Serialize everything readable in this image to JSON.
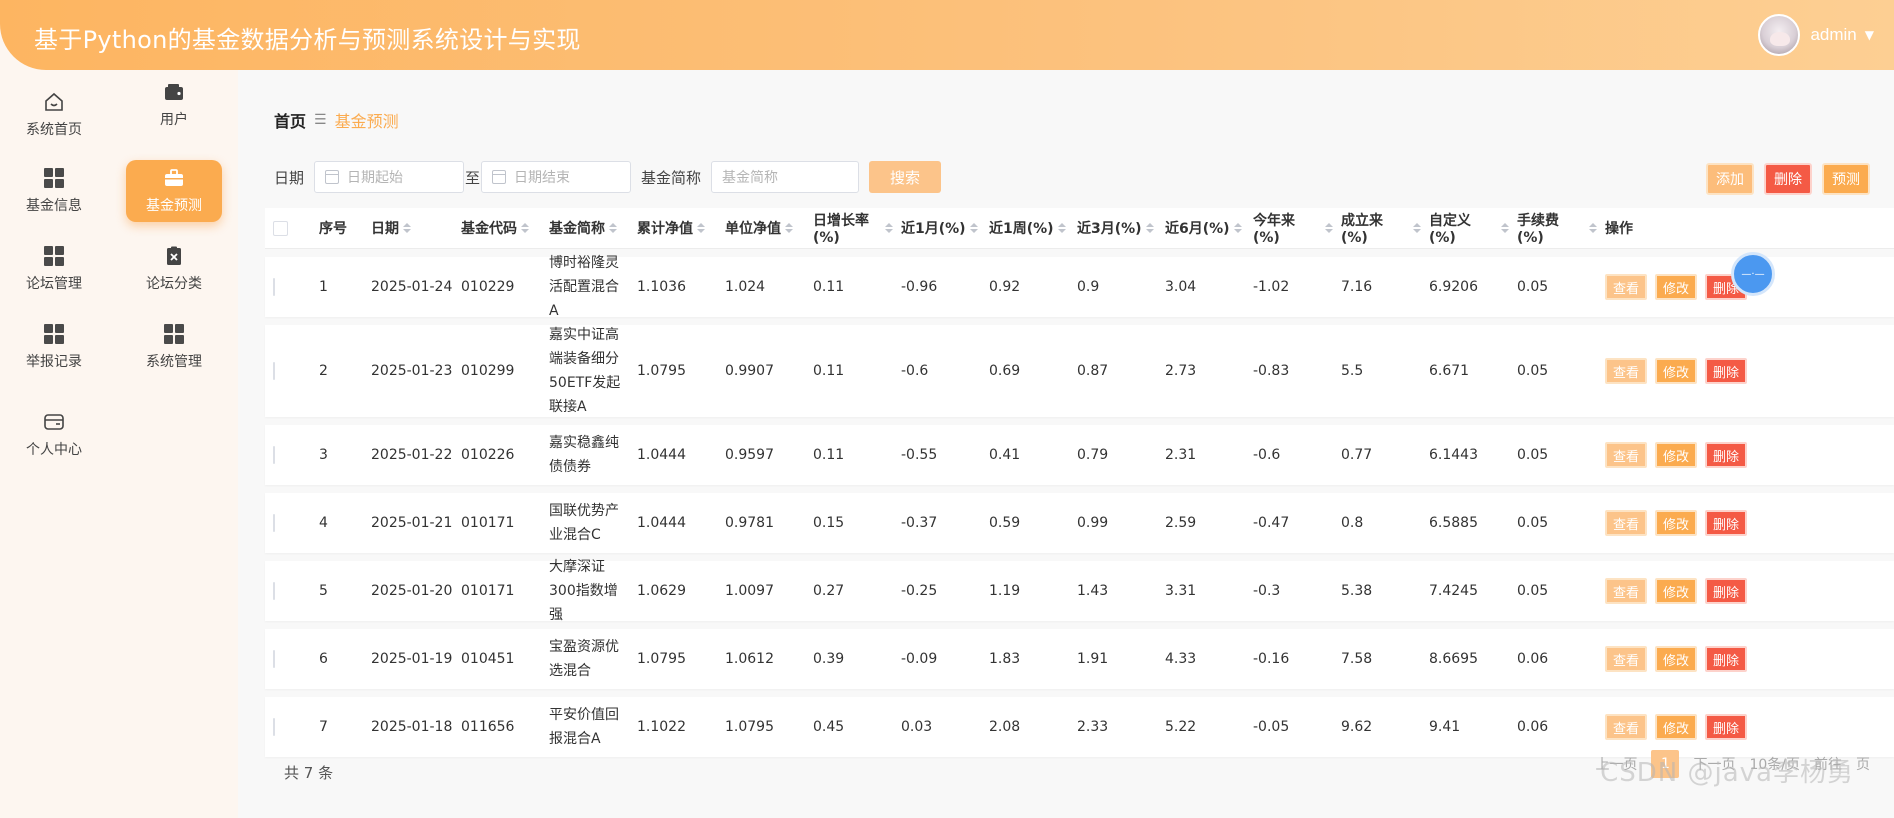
{
  "header": {
    "title": "基于Python的基金数据分析与预测系统设计与实现",
    "username": "admin"
  },
  "sidebar": {
    "items": [
      {
        "label": "系统首页",
        "icon": "home-icon"
      },
      {
        "label": "用户",
        "icon": "wallet-icon"
      },
      {
        "label": "基金信息",
        "icon": "grid-icon"
      },
      {
        "label": "基金预测",
        "icon": "briefcase-icon",
        "active": true
      },
      {
        "label": "论坛管理",
        "icon": "grid-icon"
      },
      {
        "label": "论坛分类",
        "icon": "clipboard-x-icon"
      },
      {
        "label": "举报记录",
        "icon": "grid-icon"
      },
      {
        "label": "系统管理",
        "icon": "grid-icon"
      },
      {
        "label": "个人中心",
        "icon": "card-icon"
      }
    ]
  },
  "breadcrumb": {
    "home": "首页",
    "current": "基金预测"
  },
  "filters": {
    "date_label": "日期",
    "start_placeholder": "日期起始",
    "to_label": "至",
    "end_placeholder": "日期结束",
    "name_label": "基金简称",
    "name_placeholder": "基金简称",
    "search_label": "搜索"
  },
  "actions": {
    "add": "添加",
    "delete": "删除",
    "predict": "预测"
  },
  "table": {
    "headers": [
      "序号",
      "日期",
      "基金代码",
      "基金简称",
      "累计净值",
      "单位净值",
      "日增长率(%)",
      "近1月(%)",
      "近1周(%)",
      "近3月(%)",
      "近6月(%)",
      "今年来(%)",
      "成立来(%)",
      "自定义(%)",
      "手续费(%)",
      "操作"
    ],
    "rows": [
      [
        "1",
        "2025-01-24",
        "010229",
        "博时裕隆灵活配置混合A",
        "1.1036",
        "1.024",
        "0.11",
        "-0.96",
        "0.92",
        "0.9",
        "3.04",
        "-1.02",
        "7.16",
        "6.9206",
        "0.05"
      ],
      [
        "2",
        "2025-01-23",
        "010299",
        "嘉实中证高端装备细分50ETF发起联接A",
        "1.0795",
        "0.9907",
        "0.11",
        "-0.6",
        "0.69",
        "0.87",
        "2.73",
        "-0.83",
        "5.5",
        "6.671",
        "0.05"
      ],
      [
        "3",
        "2025-01-22",
        "010226",
        "嘉实稳鑫纯债债券",
        "1.0444",
        "0.9597",
        "0.11",
        "-0.55",
        "0.41",
        "0.79",
        "2.31",
        "-0.6",
        "0.77",
        "6.1443",
        "0.05"
      ],
      [
        "4",
        "2025-01-21",
        "010171",
        "国联优势产业混合C",
        "1.0444",
        "0.9781",
        "0.15",
        "-0.37",
        "0.59",
        "0.99",
        "2.59",
        "-0.47",
        "0.8",
        "6.5885",
        "0.05"
      ],
      [
        "5",
        "2025-01-20",
        "010171",
        "大摩深证300指数增强",
        "1.0629",
        "1.0097",
        "0.27",
        "-0.25",
        "1.19",
        "1.43",
        "3.31",
        "-0.3",
        "5.38",
        "7.4245",
        "0.05"
      ],
      [
        "6",
        "2025-01-19",
        "010451",
        "宝盈资源优选混合",
        "1.0795",
        "1.0612",
        "0.39",
        "-0.09",
        "1.83",
        "1.91",
        "4.33",
        "-0.16",
        "7.58",
        "8.6695",
        "0.06"
      ],
      [
        "7",
        "2025-01-18",
        "011656",
        "平安价值回报混合A",
        "1.1022",
        "1.0795",
        "0.45",
        "0.03",
        "2.08",
        "2.33",
        "5.22",
        "-0.05",
        "9.62",
        "9.41",
        "0.06"
      ]
    ],
    "row_actions": {
      "view": "查看",
      "edit": "修改",
      "remove": "删除"
    }
  },
  "footer": {
    "total": "共 7 条"
  },
  "pager": {
    "prev": "上一页",
    "page": "1",
    "next": "下一页",
    "size": "10条/页",
    "goto": "前往",
    "page_unit": "页"
  },
  "watermark": "CSDN @java李杨勇"
}
